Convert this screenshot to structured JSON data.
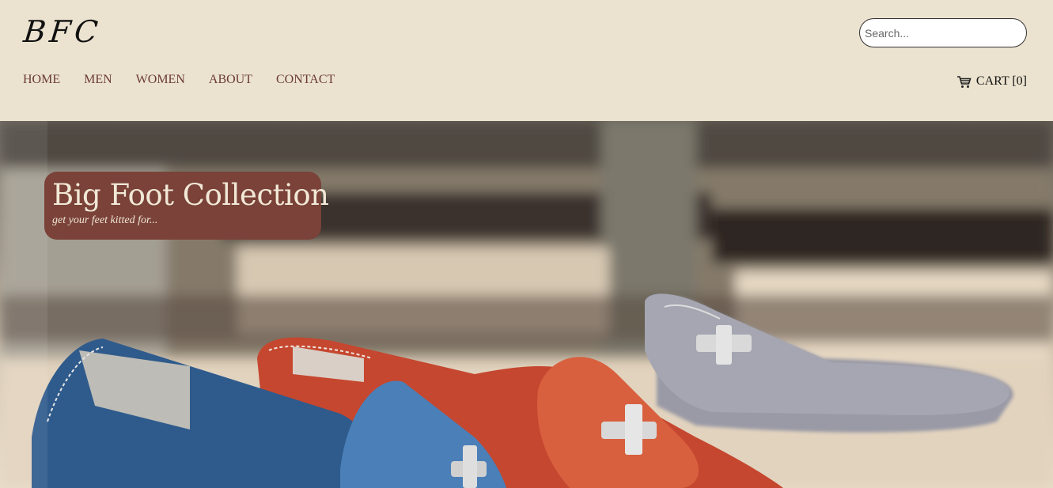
{
  "header": {
    "logo": "BFC",
    "search_placeholder": "Search...",
    "cart_label": "CART [0]"
  },
  "nav": {
    "items": [
      {
        "label": "HOME"
      },
      {
        "label": "MEN"
      },
      {
        "label": "WOMEN"
      },
      {
        "label": "ABOUT"
      },
      {
        "label": "CONTACT"
      }
    ]
  },
  "hero": {
    "title": "Big Foot Collection",
    "subtitle": "get your feet kitted for..."
  },
  "icons": {
    "cart": "shopping-cart-icon"
  },
  "colors": {
    "header_bg": "#ebe3cf",
    "nav_text": "#6b3b33",
    "brand_box": "#7a4238",
    "brand_text": "#f1e8d6"
  }
}
